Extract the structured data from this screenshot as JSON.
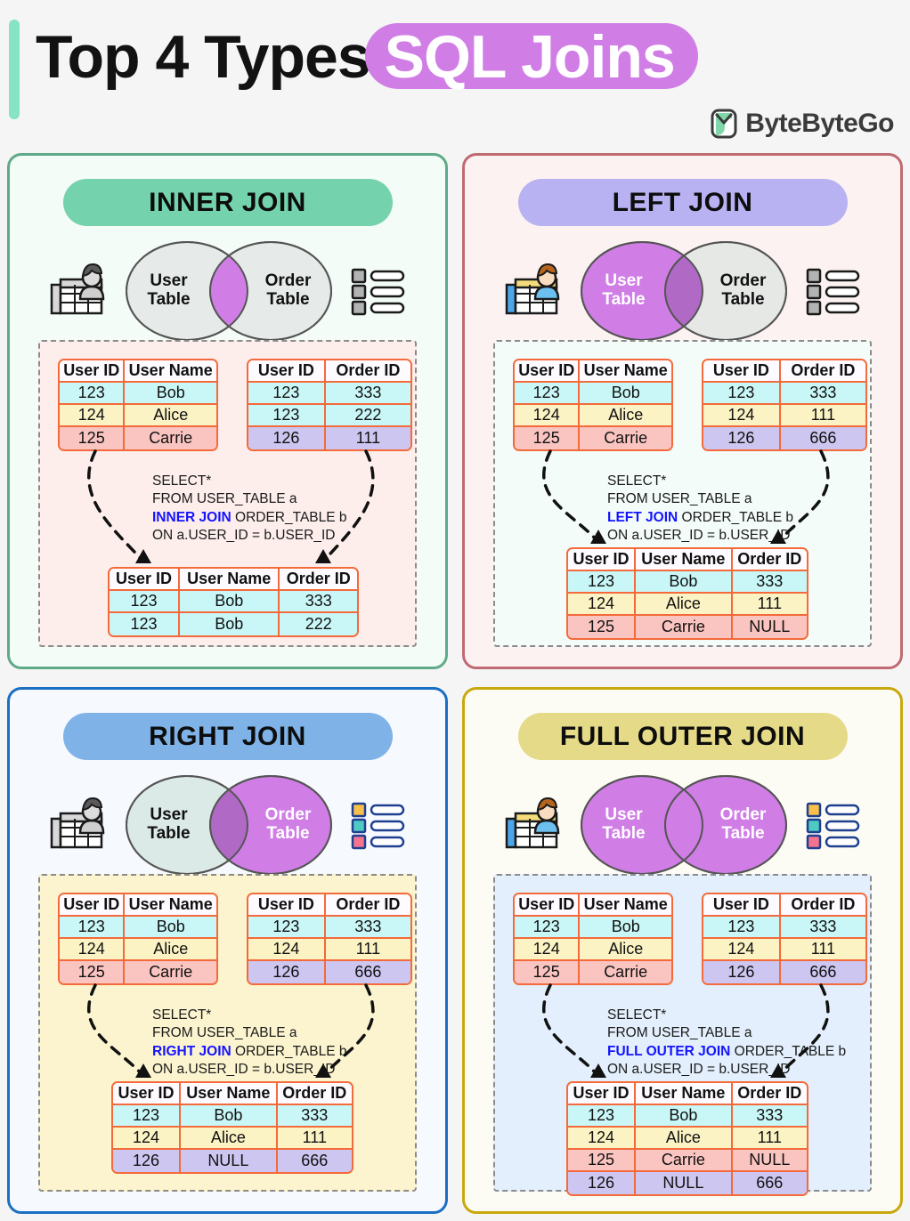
{
  "header": {
    "title_main": "Top 4 Types",
    "title_highlight": "SQL Joins",
    "brand": "ByteByteGo",
    "accent_color": "#86e3c4",
    "highlight_color": "#d07ee6"
  },
  "labels": {
    "user_table": "User\nTable",
    "order_table": "Order\nTable",
    "col_user_id": "User ID",
    "col_user_name": "User Name",
    "col_order_id": "Order ID",
    "null": "NULL"
  },
  "panels": [
    {
      "id": "inner-join",
      "title": "INNER JOIN",
      "border_color": "#5faa88",
      "bg_color": "#f3fcf7",
      "banner_color": "#74d3ad",
      "dashed_bg": "#fdeeec",
      "venn": {
        "left_fill": "#e6ebe9",
        "right_fill": "#e6ebe9",
        "overlap_fill": "#d07ee6",
        "left_text_color": "#111111",
        "right_text_color": "#111111",
        "icons_colored": false
      },
      "left_table": {
        "headers": [
          "User ID",
          "User Name"
        ],
        "rows": [
          {
            "cells": [
              "123",
              "Bob"
            ],
            "tone": "c-cyan"
          },
          {
            "cells": [
              "124",
              "Alice"
            ],
            "tone": "c-yellow"
          },
          {
            "cells": [
              "125",
              "Carrie"
            ],
            "tone": "c-red"
          }
        ]
      },
      "right_table": {
        "headers": [
          "User ID",
          "Order ID"
        ],
        "rows": [
          {
            "cells": [
              "123",
              "333"
            ],
            "tone": "c-cyan"
          },
          {
            "cells": [
              "123",
              "222"
            ],
            "tone": "c-cyan"
          },
          {
            "cells": [
              "126",
              "111"
            ],
            "tone": "c-purple"
          }
        ]
      },
      "sql": {
        "line1": "SELECT*",
        "line2": "FROM USER_TABLE a",
        "keyword": "INNER JOIN",
        "line3_rest": " ORDER_TABLE b",
        "line4": "ON a.USER_ID = b.USER_ID"
      },
      "result_table": {
        "headers": [
          "User ID",
          "User Name",
          "Order ID"
        ],
        "rows": [
          {
            "cells": [
              "123",
              "Bob",
              "333"
            ],
            "tone": "c-cyan",
            "nulls": []
          },
          {
            "cells": [
              "123",
              "Bob",
              "222"
            ],
            "tone": "c-cyan",
            "nulls": []
          }
        ]
      }
    },
    {
      "id": "left-join",
      "title": "LEFT JOIN",
      "border_color": "#c06a72",
      "bg_color": "#fdf2f2",
      "banner_color": "#b9b2f2",
      "dashed_bg": "#f4fcfa",
      "venn": {
        "left_fill": "#d07ee6",
        "right_fill": "#e6e8e6",
        "overlap_fill": "#b06ac6",
        "left_text_color": "#ffffff",
        "right_text_color": "#111111",
        "icons_colored": true,
        "list_colored": false
      },
      "left_table": {
        "headers": [
          "User ID",
          "User Name"
        ],
        "rows": [
          {
            "cells": [
              "123",
              "Bob"
            ],
            "tone": "c-cyan"
          },
          {
            "cells": [
              "124",
              "Alice"
            ],
            "tone": "c-yellow"
          },
          {
            "cells": [
              "125",
              "Carrie"
            ],
            "tone": "c-red"
          }
        ]
      },
      "right_table": {
        "headers": [
          "User ID",
          "Order ID"
        ],
        "rows": [
          {
            "cells": [
              "123",
              "333"
            ],
            "tone": "c-cyan"
          },
          {
            "cells": [
              "124",
              "111"
            ],
            "tone": "c-yellow"
          },
          {
            "cells": [
              "126",
              "666"
            ],
            "tone": "c-purple"
          }
        ]
      },
      "sql": {
        "line1": "SELECT*",
        "line2": "FROM USER_TABLE a",
        "keyword": "LEFT JOIN",
        "line3_rest": " ORDER_TABLE b",
        "line4": "ON a.USER_ID = b.USER_ID"
      },
      "result_table": {
        "headers": [
          "User ID",
          "User Name",
          "Order ID"
        ],
        "rows": [
          {
            "cells": [
              "123",
              "Bob",
              "333"
            ],
            "tone": "c-cyan",
            "nulls": []
          },
          {
            "cells": [
              "124",
              "Alice",
              "111"
            ],
            "tone": "c-yellow",
            "nulls": []
          },
          {
            "cells": [
              "125",
              "Carrie",
              "NULL"
            ],
            "tone": "c-red",
            "nulls": [
              2
            ]
          }
        ]
      }
    },
    {
      "id": "right-join",
      "title": "RIGHT JOIN",
      "border_color": "#1a6fc4",
      "bg_color": "#f6f9fe",
      "banner_color": "#7fb3e8",
      "dashed_bg": "#fcf4cf",
      "venn": {
        "left_fill": "#dbeae6",
        "right_fill": "#d07ee6",
        "overlap_fill": "#b06ac6",
        "left_text_color": "#111111",
        "right_text_color": "#ffffff",
        "icons_colored": false,
        "list_colored": true
      },
      "left_table": {
        "headers": [
          "User ID",
          "User Name"
        ],
        "rows": [
          {
            "cells": [
              "123",
              "Bob"
            ],
            "tone": "c-cyan"
          },
          {
            "cells": [
              "124",
              "Alice"
            ],
            "tone": "c-yellow"
          },
          {
            "cells": [
              "125",
              "Carrie"
            ],
            "tone": "c-red"
          }
        ]
      },
      "right_table": {
        "headers": [
          "User ID",
          "Order ID"
        ],
        "rows": [
          {
            "cells": [
              "123",
              "333"
            ],
            "tone": "c-cyan"
          },
          {
            "cells": [
              "124",
              "111"
            ],
            "tone": "c-yellow"
          },
          {
            "cells": [
              "126",
              "666"
            ],
            "tone": "c-purple"
          }
        ]
      },
      "sql": {
        "line1": "SELECT*",
        "line2": "FROM USER_TABLE a",
        "keyword": "RIGHT JOIN",
        "line3_rest": " ORDER_TABLE b",
        "line4": "ON a.USER_ID = b.USER_ID"
      },
      "result_table": {
        "headers": [
          "User ID",
          "User Name",
          "Order ID"
        ],
        "rows": [
          {
            "cells": [
              "123",
              "Bob",
              "333"
            ],
            "tone": "c-cyan",
            "nulls": []
          },
          {
            "cells": [
              "124",
              "Alice",
              "111"
            ],
            "tone": "c-yellow",
            "nulls": []
          },
          {
            "cells": [
              "126",
              "NULL",
              "666"
            ],
            "tone": "c-purple",
            "nulls": [
              1
            ]
          }
        ]
      }
    },
    {
      "id": "full-outer-join",
      "title": "FULL OUTER JOIN",
      "border_color": "#c8a80d",
      "bg_color": "#fdfcf4",
      "banner_color": "#e4da87",
      "dashed_bg": "#e3effc",
      "venn": {
        "left_fill": "#d07ee6",
        "right_fill": "#d07ee6",
        "overlap_fill": "#d07ee6",
        "left_text_color": "#ffffff",
        "right_text_color": "#ffffff",
        "icons_colored": true,
        "list_colored": true
      },
      "left_table": {
        "headers": [
          "User ID",
          "User Name"
        ],
        "rows": [
          {
            "cells": [
              "123",
              "Bob"
            ],
            "tone": "c-cyan"
          },
          {
            "cells": [
              "124",
              "Alice"
            ],
            "tone": "c-yellow"
          },
          {
            "cells": [
              "125",
              "Carrie"
            ],
            "tone": "c-red"
          }
        ]
      },
      "right_table": {
        "headers": [
          "User ID",
          "Order ID"
        ],
        "rows": [
          {
            "cells": [
              "123",
              "333"
            ],
            "tone": "c-cyan"
          },
          {
            "cells": [
              "124",
              "111"
            ],
            "tone": "c-yellow"
          },
          {
            "cells": [
              "126",
              "666"
            ],
            "tone": "c-purple"
          }
        ]
      },
      "sql": {
        "line1": "SELECT*",
        "line2": "FROM USER_TABLE a",
        "keyword": "FULL OUTER JOIN",
        "line3_rest": " ORDER_TABLE b",
        "line4": "ON a.USER_ID = b.USER_ID"
      },
      "result_table": {
        "headers": [
          "User ID",
          "User Name",
          "Order ID"
        ],
        "rows": [
          {
            "cells": [
              "123",
              "Bob",
              "333"
            ],
            "tone": "c-cyan",
            "nulls": []
          },
          {
            "cells": [
              "124",
              "Alice",
              "111"
            ],
            "tone": "c-yellow",
            "nulls": []
          },
          {
            "cells": [
              "125",
              "Carrie",
              "NULL"
            ],
            "tone": "c-red",
            "nulls": [
              2
            ]
          },
          {
            "cells": [
              "126",
              "NULL",
              "666"
            ],
            "tone": "c-purple",
            "nulls": [
              1
            ]
          }
        ]
      }
    }
  ]
}
